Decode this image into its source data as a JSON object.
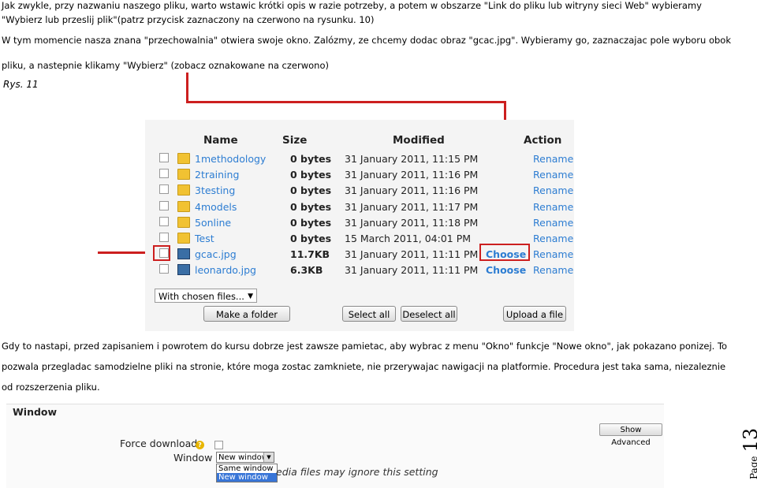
{
  "paragraphs": {
    "p1_line1": "Jak zwykle, przy nazwaniu naszego pliku, warto wstawic krótki opis w razie potrzeby, a potem w obszarze \"Link do pliku lub witryny sieci Web\" wybieramy",
    "p1_line2": "\"Wybierz lub przeslij plik\"(patrz przycisk zaznaczony na czerwono na rysunku. 10)",
    "p2_line1": "W tym momencie nasza znana \"przechowalnia\" otwiera swoje okno. Zalózmy, ze chcemy dodac obraz \"gcac.jpg\". Wybieramy go, zaznaczajac pole wyboru obok",
    "p2_line2": "pliku, a nastepnie klikamy \"Wybierz\" (zobacz oznakowane na czerwono)",
    "caption": "Rys. 11",
    "p3_line1": "Gdy to nastapi, przed zapisaniem i powrotem do kursu dobrze jest zawsze pamietac, aby wybrac z menu \"Okno\" funkcje \"Nowe okno\", jak pokazano ponizej. To",
    "p3_line2": "pozwala przegladac samodzielne pliki na stronie, które moga zostac zamkniete, nie przerywajac nawigacji na platformie. Procedura jest taka sama, niezaleznie",
    "p3_line3": "od rozszerzenia pliku."
  },
  "file_manager": {
    "headers": {
      "name": "Name",
      "size": "Size",
      "modified": "Modified",
      "action": "Action"
    },
    "rows": [
      {
        "icon": "folder-icon",
        "name": "1methodology",
        "size": "0 bytes",
        "modified": "31 January 2011, 11:15 PM",
        "action": "Rename"
      },
      {
        "icon": "folder-icon",
        "name": "2training",
        "size": "0 bytes",
        "modified": "31 January 2011, 11:16 PM",
        "action": "Rename"
      },
      {
        "icon": "folder-icon",
        "name": "3testing",
        "size": "0 bytes",
        "modified": "31 January 2011, 11:16 PM",
        "action": "Rename"
      },
      {
        "icon": "folder-icon",
        "name": "4models",
        "size": "0 bytes",
        "modified": "31 January 2011, 11:17 PM",
        "action": "Rename"
      },
      {
        "icon": "folder-icon",
        "name": "5online",
        "size": "0 bytes",
        "modified": "31 January 2011, 11:18 PM",
        "action": "Rename"
      },
      {
        "icon": "folder-icon",
        "name": "Test",
        "size": "0 bytes",
        "modified": "15 March 2011, 04:01 PM",
        "action": "Rename"
      },
      {
        "icon": "image-icon",
        "name": "gcac.jpg",
        "size": "11.7KB",
        "modified": "31 January 2011, 11:11 PM",
        "choose": "Choose",
        "action": "Rename"
      },
      {
        "icon": "image-icon",
        "name": "leonardo.jpg",
        "size": "6.3KB",
        "modified": "31 January 2011, 11:11 PM",
        "choose": "Choose",
        "action": "Rename"
      }
    ],
    "with_chosen": "With chosen files...",
    "make_folder": "Make a folder",
    "select_all": "Select all",
    "deselect_all": "Deselect all",
    "upload": "Upload a file"
  },
  "window_settings": {
    "title": "Window",
    "force_download": "Force download",
    "window_label": "Window",
    "selected": "New window",
    "options": [
      "Same window",
      "New window"
    ],
    "note": "edia files may ignore this setting",
    "show_advanced": "Show Advanced",
    "help": "?"
  },
  "footer": {
    "page_word": "Page",
    "page_number": "13"
  },
  "colors": {
    "highlight_red": "#cc1f1f",
    "link_blue": "#2d7dd2"
  }
}
